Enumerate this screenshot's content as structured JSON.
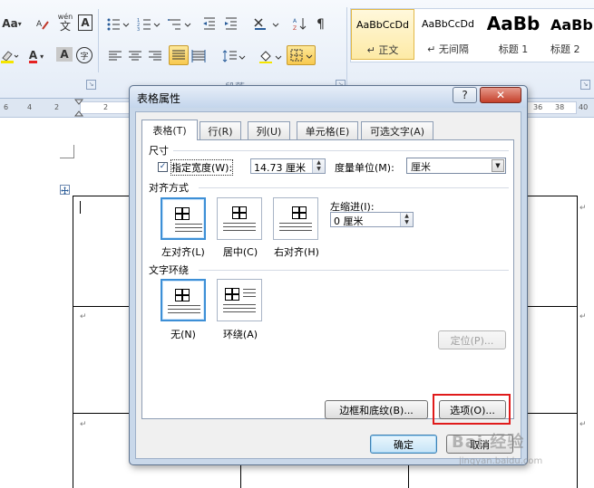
{
  "ribbon": {
    "font_size_label": "Aa",
    "font_size_menu": "▾",
    "ruby_label": "wén",
    "ruby_char": "文",
    "charborder_label": "A",
    "font_color_label": "A",
    "highlight_label": "aby",
    "charshade_label": "A",
    "enclose_label": "字",
    "group_paragraph": "段落",
    "styles": [
      {
        "sample": "AaBbCcDd",
        "name": "↵ 正文"
      },
      {
        "sample": "AaBbCcDd",
        "name": "↵ 无间隔"
      },
      {
        "sample": "AaBb",
        "name": "标题 1"
      },
      {
        "sample": "AaBb",
        "name": "标题 2"
      }
    ]
  },
  "ruler": {
    "ticks": [
      "6",
      "4",
      "2",
      "2",
      "36",
      "38",
      "40"
    ]
  },
  "document": {
    "para_mark": "↵"
  },
  "dialog": {
    "title": "表格属性",
    "help_label": "?",
    "close_label": "✕",
    "tabs": [
      "表格(T)",
      "行(R)",
      "列(U)",
      "单元格(E)",
      "可选文字(A)"
    ],
    "size": {
      "label": "尺寸",
      "preferred_width_label": "指定宽度(W):",
      "preferred_width_checked": true,
      "width_value": "14.73 厘米",
      "measure_label": "度量单位(M):",
      "measure_value": "厘米"
    },
    "alignment": {
      "label": "对齐方式",
      "options": [
        "左对齐(L)",
        "居中(C)",
        "右对齐(H)"
      ],
      "selected": "左对齐(L)",
      "indent_label": "左缩进(I):",
      "indent_value": "0 厘米"
    },
    "wrapping": {
      "label": "文字环绕",
      "options": [
        "无(N)",
        "环绕(A)"
      ],
      "selected": "无(N)",
      "positioning_label": "定位(P)..."
    },
    "borders_label": "边框和底纹(B)...",
    "options_label": "选项(O)...",
    "ok_label": "确定",
    "cancel_label": "取消"
  },
  "watermark": {
    "text": "Bai 经验",
    "sub": "jingyan.baidu.com"
  }
}
